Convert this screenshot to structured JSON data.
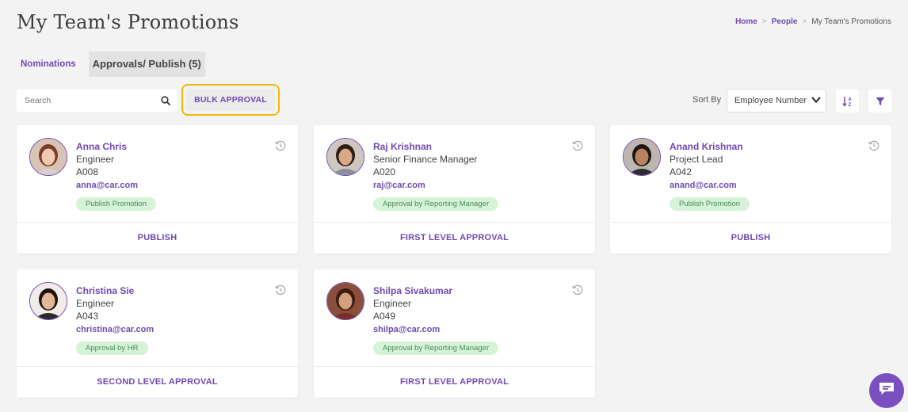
{
  "page": {
    "title": "My Team's Promotions"
  },
  "breadcrumb": {
    "home": "Home",
    "people": "People",
    "current": "My Team's Promotions",
    "separator": ">"
  },
  "tabs": {
    "nominations": "Nominations",
    "approvals": "Approvals/ Publish (5)"
  },
  "toolbar": {
    "search_placeholder": "Search",
    "bulk_approval": "BULK APPROVAL",
    "sort_label": "Sort By",
    "sort_value": "Employee Number"
  },
  "colors": {
    "accent": "#6f4ab1",
    "highlight": "#f2b90c",
    "badge_bg": "#d6f2d9",
    "badge_text": "#4a8d55"
  },
  "cards": [
    {
      "name": "Anna Chris",
      "role": "Engineer",
      "emp_no": "A008",
      "email": "anna@car.com",
      "status": "Publish Promotion",
      "action": "PUBLISH"
    },
    {
      "name": "Raj Krishnan",
      "role": "Senior Finance Manager",
      "emp_no": "A020",
      "email": "raj@car.com",
      "status": "Approval by Reporting Manager",
      "action": "FIRST LEVEL APPROVAL"
    },
    {
      "name": "Anand Krishnan",
      "role": "Project Lead",
      "emp_no": "A042",
      "email": "anand@car.com",
      "status": "Publish Promotion",
      "action": "PUBLISH"
    },
    {
      "name": "Christina Sie",
      "role": "Engineer",
      "emp_no": "A043",
      "email": "christina@car.com",
      "status": "Approval by HR",
      "action": "SECOND LEVEL APPROVAL"
    },
    {
      "name": "Shilpa Sivakumar",
      "role": "Engineer",
      "emp_no": "A049",
      "email": "shilpa@car.com",
      "status": "Approval by Reporting Manager",
      "action": "FIRST LEVEL APPROVAL"
    }
  ],
  "icons": {
    "search": "search-icon",
    "sort_order": "sort-az-icon",
    "filter": "filter-icon",
    "history": "history-icon",
    "chat": "chat-icon"
  }
}
